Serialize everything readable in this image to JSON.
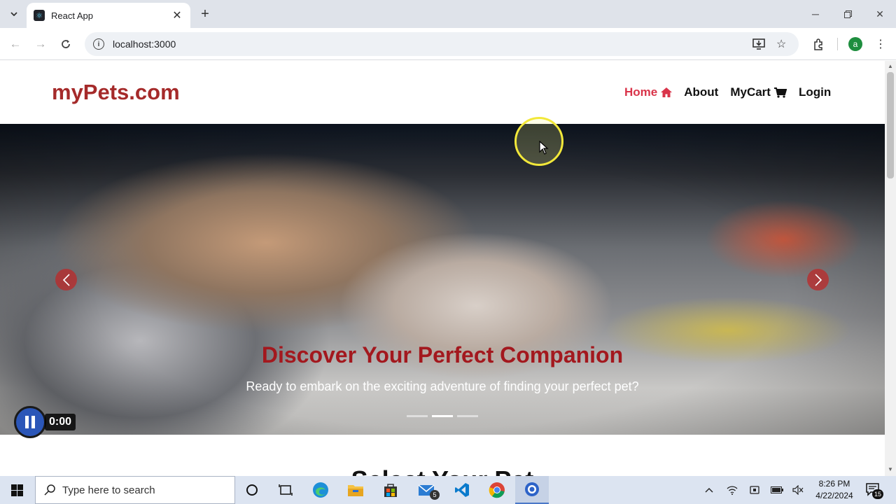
{
  "browser": {
    "tab_title": "React App",
    "url": "localhost:3000",
    "profile_initial": "a"
  },
  "site": {
    "logo": "myPets.com",
    "nav": [
      {
        "label": "Home",
        "icon": "home-icon",
        "active": true
      },
      {
        "label": "About",
        "icon": "",
        "active": false
      },
      {
        "label": "MyCart",
        "icon": "cart-icon",
        "active": false
      },
      {
        "label": "Login",
        "icon": "",
        "active": false
      }
    ],
    "hero": {
      "title": "Discover Your Perfect Companion",
      "subtitle": "Ready to embark on the exciting adventure of finding your perfect pet?",
      "slide_count": 3,
      "active_slide": 1
    },
    "section_heading": "Select Your Pet"
  },
  "recorder": {
    "time": "0:00"
  },
  "taskbar": {
    "search_placeholder": "Type here to search",
    "mail_badge": "5",
    "time": "8:26 PM",
    "date": "4/22/2024",
    "notification_count": "15"
  },
  "colors": {
    "logo": "#a52a2a",
    "nav_active": "#d9344a",
    "hero_title": "#a3181e"
  }
}
